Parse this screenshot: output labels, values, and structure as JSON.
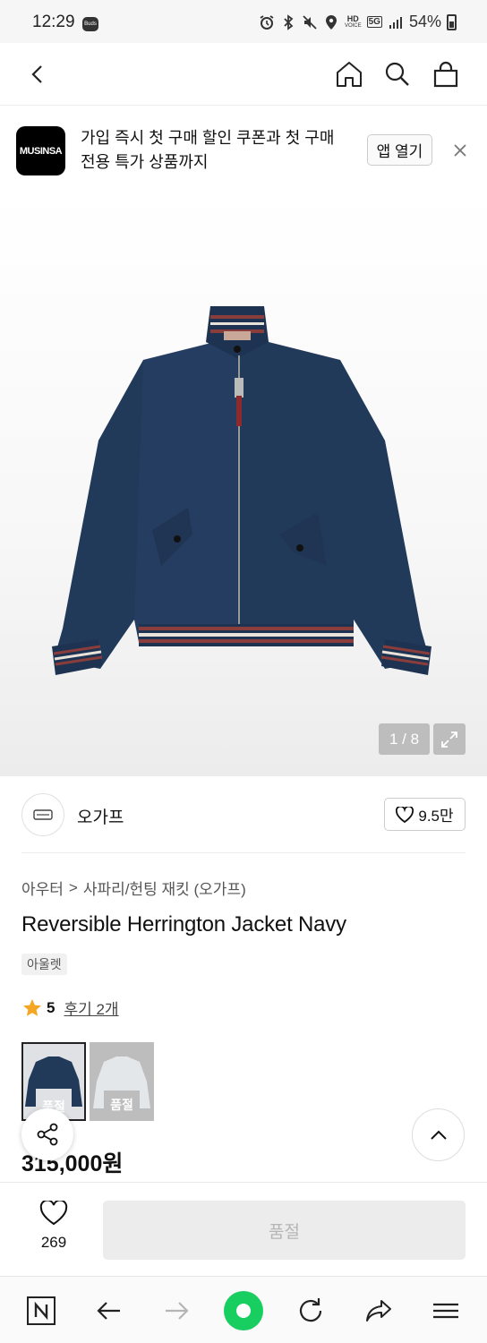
{
  "status_bar": {
    "time": "12:29",
    "badge": "Buds",
    "hd_label": "HD",
    "voice_label": "VOICE",
    "network": "5G",
    "battery": "54%"
  },
  "banner": {
    "logo_text": "MUSINSA",
    "message": "가입 즉시 첫 구매 할인 쿠폰과 첫 구매 전용 특가 상품까지",
    "open_app_label": "앱 열기"
  },
  "gallery": {
    "counter": "1 / 8"
  },
  "brand": {
    "name": "오가프",
    "like_count": "9.5만"
  },
  "breadcrumb": {
    "category": "아우터",
    "separator": ">",
    "subcategory": "사파리/헌팅 재킷 (오가프)"
  },
  "product": {
    "title": "Reversible Herrington Jacket Navy",
    "outlet_tag": "아울렛",
    "rating": "5",
    "review_link": "후기 2개",
    "price": "315,000원"
  },
  "variants": [
    {
      "color": "navy",
      "status": "품절"
    },
    {
      "color": "light-gray",
      "status": "품절"
    }
  ],
  "purchase_bar": {
    "wish_count": "269",
    "buy_label": "품절"
  },
  "colors": {
    "accent_star": "#f5a623",
    "browser_green": "#19ce60"
  }
}
